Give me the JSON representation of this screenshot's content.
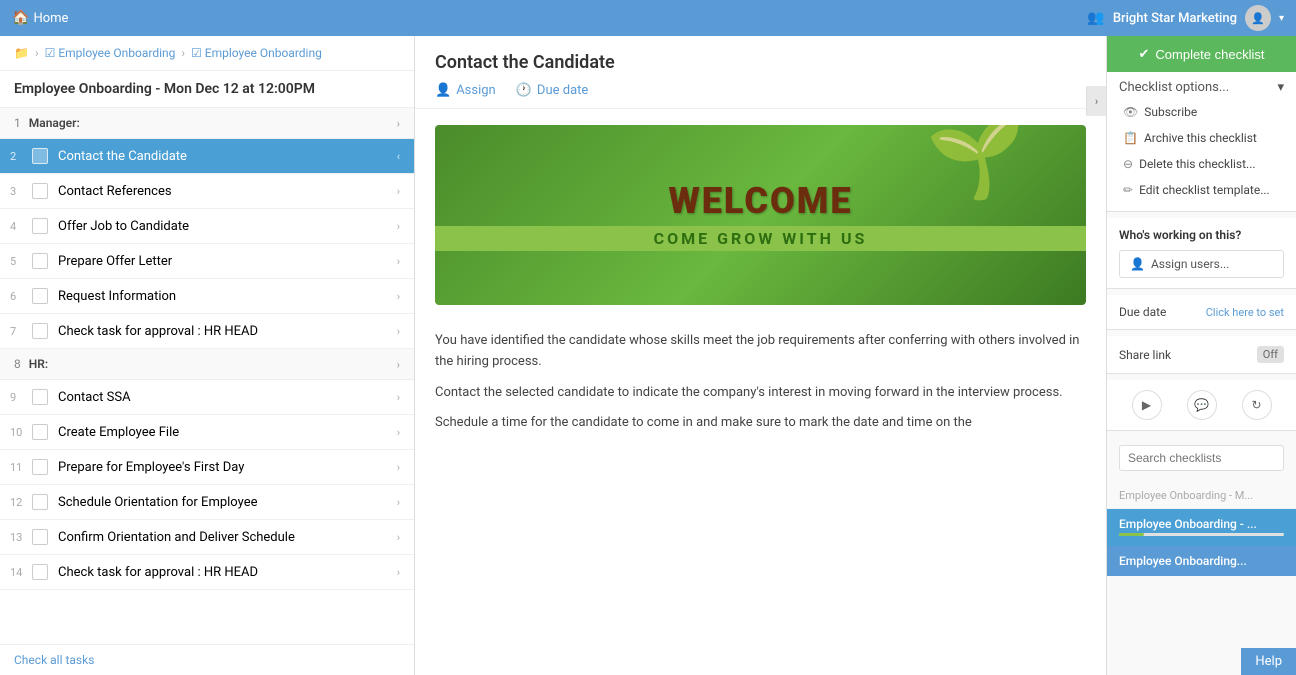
{
  "topnav": {
    "home_label": "Home",
    "org_name": "Bright Star Marketing",
    "home_icon": "🏠"
  },
  "breadcrumb": {
    "folder_icon": "📁",
    "items": [
      {
        "label": "Employee Onboarding",
        "icon": "☑"
      },
      {
        "label": "Employee Onboarding",
        "icon": "☑"
      }
    ]
  },
  "sidebar": {
    "title": "Employee Onboarding - Mon Dec 12 at 12:00PM",
    "check_all": "Check all tasks",
    "sections": [
      {
        "num": "1",
        "label": "Manager:",
        "type": "section"
      },
      {
        "num": "2",
        "label": "Contact the Candidate",
        "active": true,
        "type": "task"
      },
      {
        "num": "3",
        "label": "Contact References",
        "type": "task"
      },
      {
        "num": "4",
        "label": "Offer Job to Candidate",
        "type": "task"
      },
      {
        "num": "5",
        "label": "Prepare Offer Letter",
        "type": "task"
      },
      {
        "num": "6",
        "label": "Request Information",
        "type": "task"
      },
      {
        "num": "7",
        "label": "Check task for approval : HR HEAD",
        "type": "task"
      },
      {
        "num": "8",
        "label": "HR:",
        "type": "section"
      },
      {
        "num": "9",
        "label": "Contact SSA",
        "type": "task"
      },
      {
        "num": "10",
        "label": "Create Employee File",
        "type": "task"
      },
      {
        "num": "11",
        "label": "Prepare for Employee's First Day",
        "type": "task"
      },
      {
        "num": "12",
        "label": "Schedule Orientation for Employee",
        "type": "task"
      },
      {
        "num": "13",
        "label": "Confirm Orientation and Deliver Schedule",
        "type": "task"
      },
      {
        "num": "14",
        "label": "Check task for approval : HR HEAD",
        "type": "task"
      }
    ]
  },
  "content": {
    "title": "Contact the Candidate",
    "assign_label": "Assign",
    "due_date_label": "Due date",
    "paragraphs": [
      "You have identified the candidate whose skills meet the job requirements after conferring with others involved in the hiring process.",
      "Contact the selected candidate to indicate the company's interest in moving forward in the interview process.",
      "Schedule a time for the candidate to come in and make sure to mark the date and time on the"
    ],
    "welcome_title": "WELCOME",
    "welcome_subtitle": "COME GROW WITH US"
  },
  "right_panel": {
    "complete_btn": "Complete checklist",
    "checklist_options_label": "Checklist options...",
    "options": [
      {
        "icon": "👁",
        "label": "Subscribe"
      },
      {
        "icon": "📋",
        "label": "Archive this checklist"
      },
      {
        "icon": "🗑",
        "label": "Delete this checklist..."
      },
      {
        "icon": "✏",
        "label": "Edit checklist template..."
      }
    ],
    "working_title": "Who's working on this?",
    "assign_users_label": "Assign users...",
    "due_date_label": "Due date",
    "due_date_set": "Click here to set",
    "share_link_label": "Share link",
    "share_off": "Off",
    "search_placeholder": "Search checklists",
    "checklist_results": [
      {
        "label": "Employee Onboarding - M...",
        "dimmed": true
      },
      {
        "label": "Employee Onboarding - ...",
        "active": true
      },
      {
        "label": "Employee Onboarding...",
        "bottom": true
      }
    ],
    "help_label": "Help"
  }
}
